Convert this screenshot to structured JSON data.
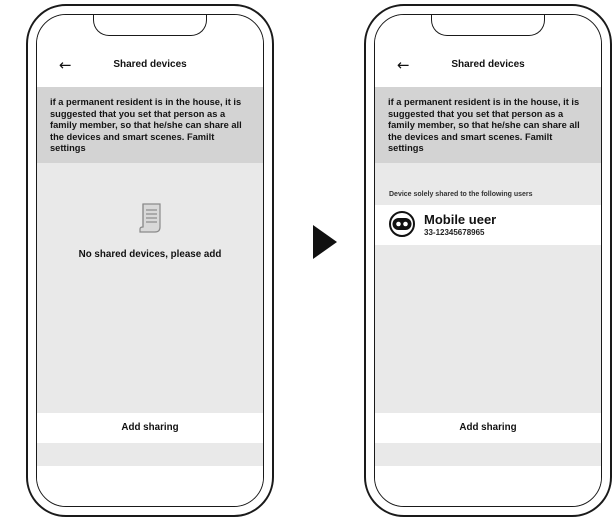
{
  "left_screen": {
    "title": "Shared devices",
    "notice": "if a permanent resident is in the house, it is suggested that you set that person as a family member, so that he/she can share all the devices and smart scenes. Familt settings",
    "empty_text": "No shared devices, please add",
    "add_button": "Add sharing"
  },
  "right_screen": {
    "title": "Shared devices",
    "notice": "if a permanent resident is in the house, it is suggested that you set that person as a family member, so that he/she can share all the devices and smart scenes. Familt settings",
    "section_label": "Device solely shared to the following users",
    "user": {
      "name": "Mobile ueer",
      "phone": "33-12345678965"
    },
    "add_button": "Add sharing"
  },
  "icons": {
    "back": "arrow-left-icon",
    "empty": "document-icon",
    "transition": "play-arrow-icon",
    "avatar": "robot-avatar-icon"
  },
  "colors": {
    "notice_bg": "#d3d3d3",
    "screen_bg": "#e9e9e9",
    "outline": "#1a1a1a"
  }
}
